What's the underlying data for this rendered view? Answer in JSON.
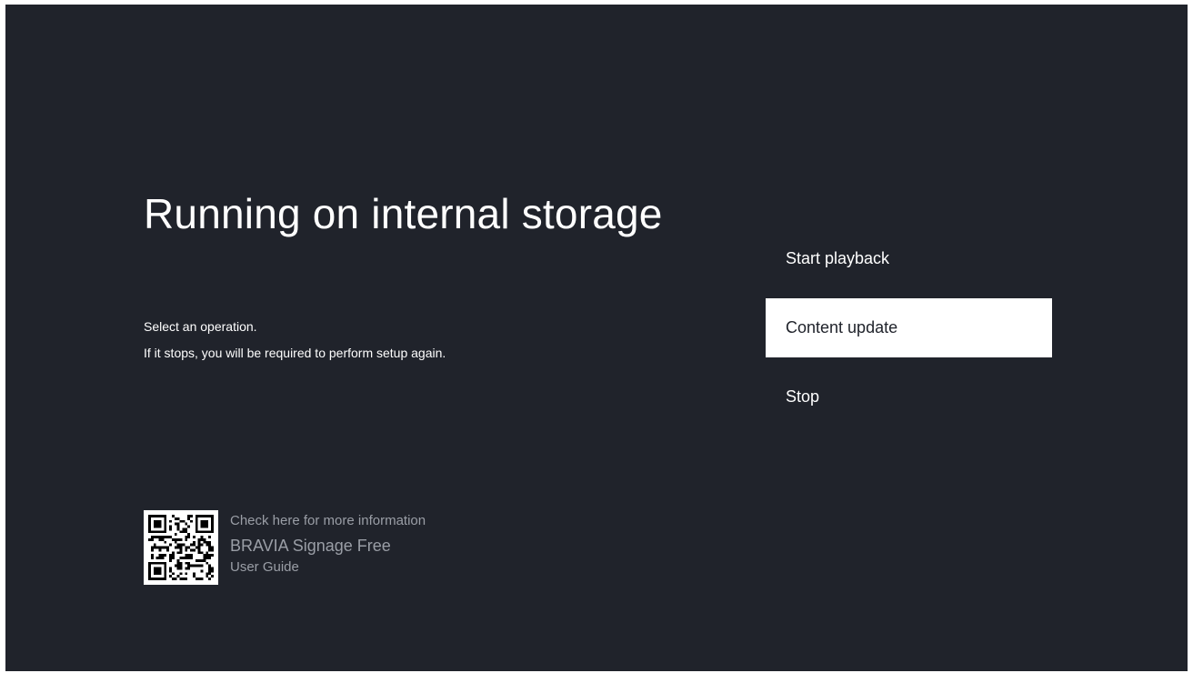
{
  "page": {
    "title": "Running on internal storage",
    "description": [
      "Select an operation.",
      "If it stops, you will be required to perform setup again."
    ]
  },
  "menu": {
    "items": [
      {
        "label": "Start playback",
        "focused": false
      },
      {
        "label": "Content update",
        "focused": true
      },
      {
        "label": "Stop",
        "focused": false
      }
    ]
  },
  "info": {
    "line1": "Check here for more information",
    "product": "BRAVIA Signage Free",
    "guide": "User Guide",
    "qr_icon": "qr-code-icon"
  },
  "colors": {
    "background": "#20232b",
    "text": "#ffffff",
    "focus_bg": "#ffffff",
    "muted_text": "#9a9ea6"
  }
}
